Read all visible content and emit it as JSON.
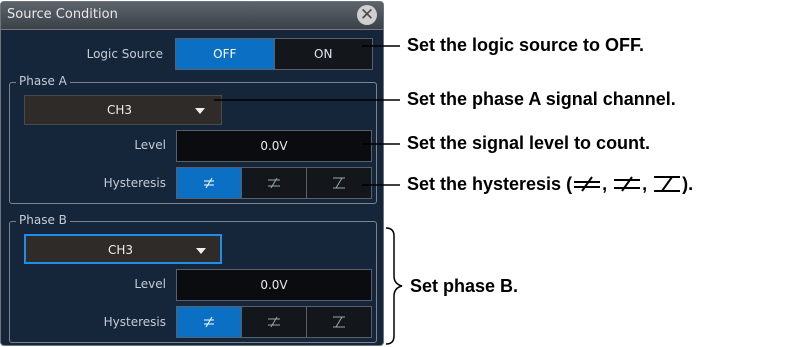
{
  "dialog": {
    "title": "Source Condition",
    "close_icon": "close-icon"
  },
  "logic_source": {
    "label": "Logic Source",
    "options": [
      "OFF",
      "ON"
    ],
    "selected": "OFF"
  },
  "phase_a": {
    "title": "Phase A",
    "channel": "CH3",
    "level_label": "Level",
    "level_value": "0.0V",
    "hysteresis_label": "Hysteresis",
    "hysteresis_options": [
      "hysteresis-small-icon",
      "hysteresis-medium-icon",
      "hysteresis-large-icon"
    ],
    "hysteresis_selected": 0
  },
  "phase_b": {
    "title": "Phase B",
    "channel": "CH3",
    "level_label": "Level",
    "level_value": "0.0V",
    "hysteresis_label": "Hysteresis",
    "hysteresis_options": [
      "hysteresis-small-icon",
      "hysteresis-medium-icon",
      "hysteresis-large-icon"
    ],
    "hysteresis_selected": 0
  },
  "annotations": {
    "logic": "Set the logic source to OFF.",
    "channel": "Set the phase A signal channel.",
    "level": "Set the signal level to count.",
    "hysteresis_prefix": "Set the hysteresis (",
    "hysteresis_suffix": ").",
    "phase_b": "Set phase B."
  },
  "colors": {
    "panel_bg": "#16263a",
    "selected_blue": "#0b6fc3",
    "focus_blue": "#1f8ee8"
  }
}
